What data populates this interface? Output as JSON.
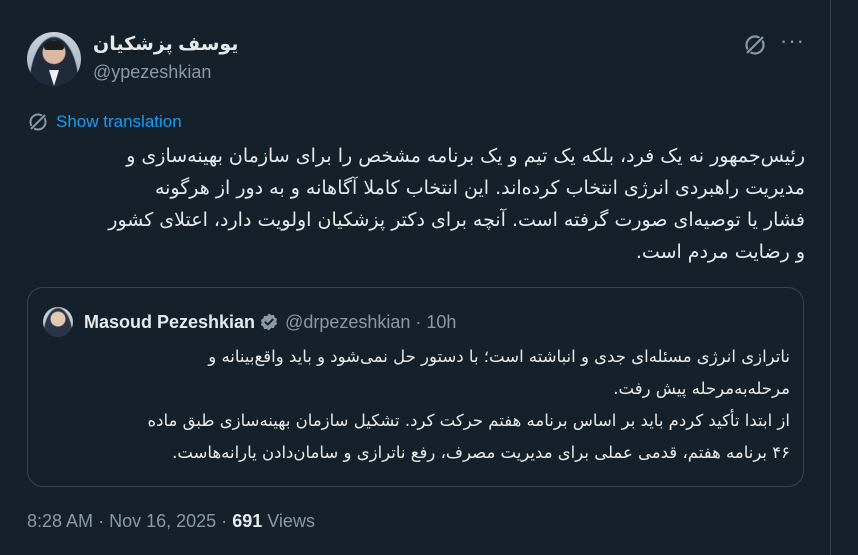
{
  "author": {
    "display_name": "یوسف پزشکیان",
    "handle": "@ypezeshkian"
  },
  "translation": {
    "label": "Show translation"
  },
  "tweet": {
    "text": "رئیس‌جمهور نه یک فرد، بلکه یک تیم و یک برنامه مشخص را برای سازمان بهینه‌سازی و\nمدیریت راهبردی انرژی انتخاب کرده‌اند. این انتخاب کاملا آگاهانه و به دور از هرگونه\nفشار یا توصیه‌ای صورت گرفته است. آنچه برای دکتر پزشکیان اولویت دارد، اعتلای کشور\nو رضایت مردم است."
  },
  "quote": {
    "name": "Masoud Pezeshkian",
    "handle": "@drpezeshkian",
    "separator": "·",
    "time": "10h",
    "text": "ناترازی انرژی مسئله‌ای جدی و انباشته است؛ با دستور حل نمی‌شود و باید واقع‌بینانه و\nمرحله‌به‌مرحله پیش رفت.\nاز ابتدا تأکید کردم باید بر اساس برنامه هفتم حرکت کرد. تشکیل سازمان بهینه‌سازی طبق ماده\n۴۶ برنامه هفتم، قدمی عملی برای مدیریت مصرف، رفع ناترازی و سامان‌دادن یارانه‌هاست."
  },
  "footer": {
    "time": "8:28 AM",
    "separator": "·",
    "date": "Nov 16, 2025",
    "views_count": "691",
    "views_label": "Views"
  },
  "icons": {
    "grok": "grok-icon",
    "more": "more-icon",
    "translate": "translate-icon",
    "verified": "verified-icon"
  },
  "colors": {
    "background": "#15202b",
    "text": "#e7e9ea",
    "secondary": "#8b98a5",
    "accent": "#1d9bf0",
    "border": "#38444d"
  }
}
